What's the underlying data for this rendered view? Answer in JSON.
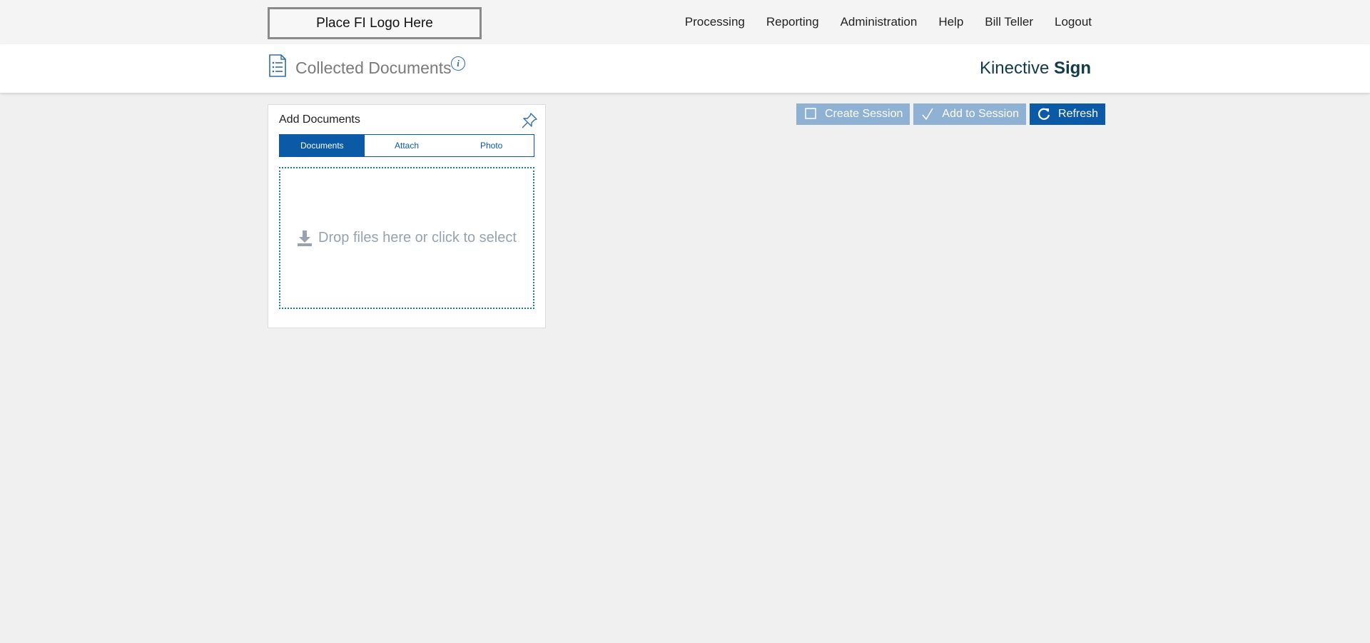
{
  "topbar": {
    "logo_text": "Place FI Logo Here",
    "nav": [
      {
        "label": "Processing"
      },
      {
        "label": "Reporting"
      },
      {
        "label": "Administration"
      },
      {
        "label": "Help"
      },
      {
        "label": "Bill Teller"
      },
      {
        "label": "Logout"
      }
    ]
  },
  "header": {
    "title": "Collected Documents",
    "info_icon_glyph": "i",
    "brand_regular": "Kinective",
    "brand_bold": "Sign"
  },
  "panel": {
    "title": "Add Documents",
    "tabs": [
      {
        "label": "Documents",
        "active": true
      },
      {
        "label": "Attach",
        "active": false
      },
      {
        "label": "Photo",
        "active": false
      }
    ],
    "dropzone_text": "Drop files here or click to select"
  },
  "actions": {
    "create_session": "Create Session",
    "add_to_session": "Add to Session",
    "refresh": "Refresh"
  },
  "colors": {
    "accent": "#0a5aa8",
    "disabled": "#8fb2d4",
    "brand": "#0f3b4a",
    "dropzone_border": "#1b7f8f"
  },
  "icons": {
    "document_list": "document-list-icon",
    "info": "info-icon",
    "pin": "pin-icon",
    "download": "download-icon",
    "checkbox": "checkbox-icon",
    "check": "check-icon",
    "refresh": "refresh-icon"
  }
}
